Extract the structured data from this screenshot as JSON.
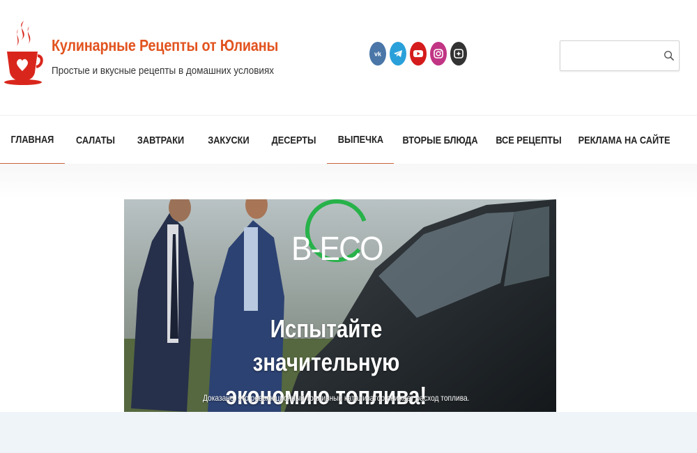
{
  "site": {
    "title": "Кулинарные Рецепты от Юлианы",
    "tagline": "Простые и вкусные рецепты в домашних условиях",
    "brand_color": "#e2531f"
  },
  "socials": [
    {
      "icon": "vk-icon",
      "color": "#4a76a8"
    },
    {
      "icon": "telegram-icon",
      "color": "#2aa0da"
    },
    {
      "icon": "youtube-icon",
      "color": "#d51c1c"
    },
    {
      "icon": "instagram-icon",
      "color": "#c13584"
    },
    {
      "icon": "odnoklassniki-icon",
      "color": "#333333"
    }
  ],
  "search": {
    "placeholder": "",
    "icon": "search-icon"
  },
  "nav": {
    "items": [
      {
        "label": "ГЛАВНАЯ",
        "active": true
      },
      {
        "label": "САЛАТЫ",
        "active": false
      },
      {
        "label": "ЗАВТРАКИ",
        "active": false
      },
      {
        "label": "ЗАКУСКИ",
        "active": false
      },
      {
        "label": "ДЕСЕРТЫ",
        "active": false
      },
      {
        "label": "ВЫПЕЧКА",
        "active": true
      },
      {
        "label": "ВТОРЫЕ БЛЮДА",
        "active": false
      },
      {
        "label": "ВСЕ РЕЦЕПТЫ",
        "active": false
      },
      {
        "label": "РЕКЛАМА НА САЙТЕ",
        "active": false
      }
    ],
    "active_underline_color": "#c8633a"
  },
  "ad": {
    "logo_text": "B-ECO",
    "logo_ring_color": "#27b24a",
    "headline": "Испытайте значительную экономию топлива!",
    "subtext": "Доказано, что революционный топливный катализатор снижает расход топлива."
  }
}
